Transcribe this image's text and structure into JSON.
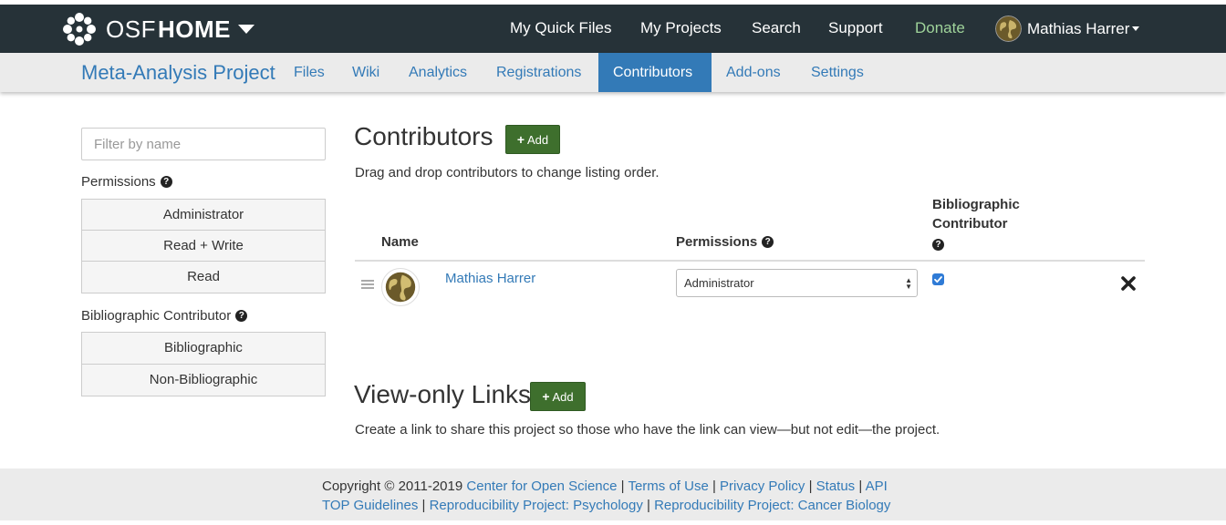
{
  "topnav": {
    "brand_osf": "OSF",
    "brand_home": "HOME",
    "links": [
      "My Quick Files",
      "My Projects",
      "Search",
      "Support",
      "Donate"
    ],
    "user_name": "Mathias Harrer"
  },
  "project_nav": {
    "title": "Meta-Analysis Project",
    "tabs": [
      "Files",
      "Wiki",
      "Analytics",
      "Registrations",
      "Contributors",
      "Add-ons",
      "Settings"
    ],
    "active_tab": "Contributors"
  },
  "sidebar": {
    "filter_placeholder": "Filter by name",
    "permissions_label": "Permissions",
    "permission_filters": [
      "Administrator",
      "Read + Write",
      "Read"
    ],
    "bibliographic_label": "Bibliographic Contributor",
    "bibliographic_filters": [
      "Bibliographic",
      "Non-Bibliographic"
    ]
  },
  "contributors": {
    "title": "Contributors",
    "add_label": "Add",
    "helptext": "Drag and drop contributors to change listing order.",
    "columns": {
      "name": "Name",
      "permissions": "Permissions",
      "bibliographic_line1": "Bibliographic",
      "bibliographic_line2": "Contributor"
    },
    "rows": [
      {
        "name": "Mathias Harrer",
        "permission": "Administrator",
        "bibliographic": true
      }
    ]
  },
  "view_only": {
    "title": "View-only Links",
    "add_label": "Add",
    "helptext": "Create a link to share this project so those who have the link can view—but not edit—the project."
  },
  "footer": {
    "copyright": "Copyright © 2011-2019",
    "links_line1": [
      "Center for Open Science",
      "Terms of Use",
      "Privacy Policy",
      "Status",
      "API"
    ],
    "links_line2": [
      "TOP Guidelines",
      "Reproducibility Project: Psychology",
      "Reproducibility Project: Cancer Biology"
    ]
  },
  "colors": {
    "topnav_bg": "#263238",
    "link_blue": "#337ab7",
    "add_green": "#3e6f2d",
    "donate_green": "#9fd39a"
  },
  "icons": {
    "brand": "osf-flower-logo",
    "brand_menu": "caret-down-icon",
    "help": "question-circle-icon",
    "drag": "drag-handle-icon",
    "remove": "close-x-icon",
    "add": "plus-icon"
  }
}
